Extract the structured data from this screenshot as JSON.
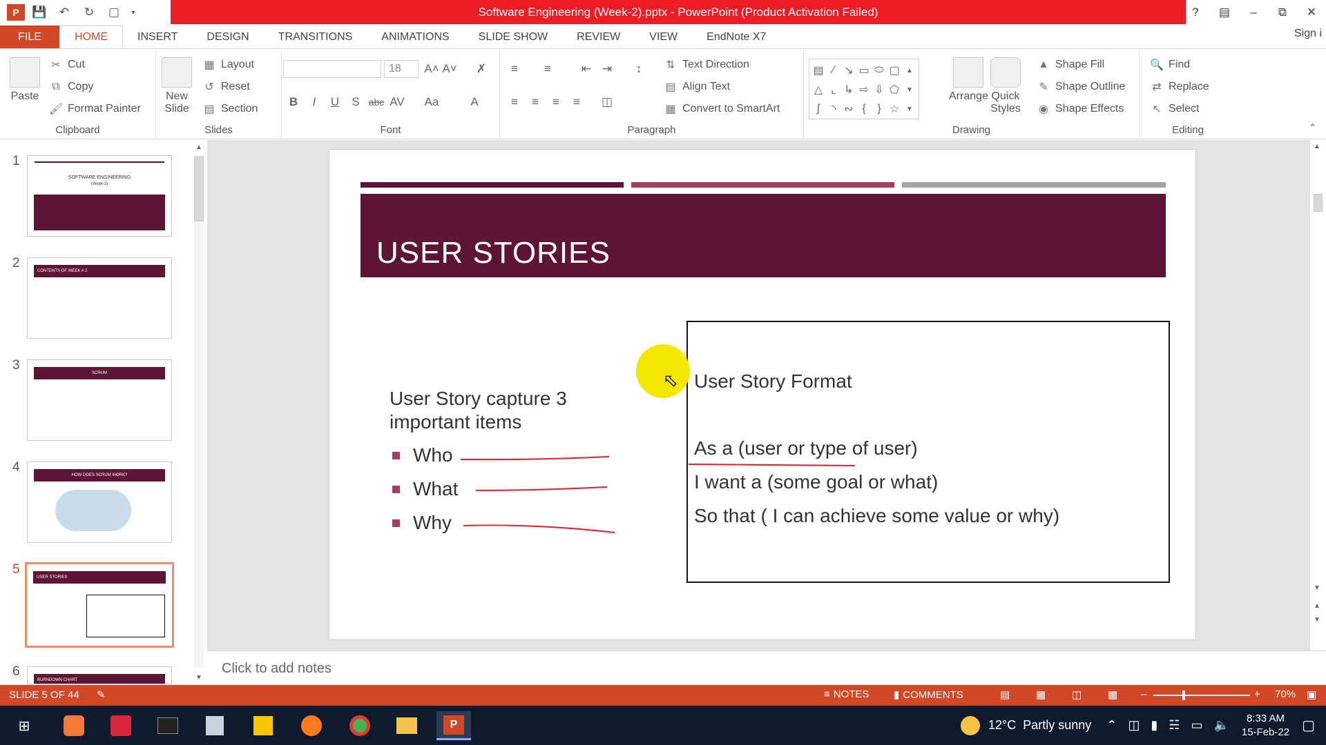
{
  "window": {
    "title": "Software Engineering (Week-2).pptx - PowerPoint (Product Activation Failed)",
    "qat_icons": [
      "powerpoint-logo-icon",
      "save-icon",
      "undo-icon",
      "redo-icon",
      "start-from-beginning-icon",
      "customize-qat-icon"
    ],
    "controls": [
      "help-icon",
      "ribbon-display-icon",
      "minimize-icon",
      "restore-icon",
      "close-icon"
    ]
  },
  "tabs": [
    "FILE",
    "HOME",
    "INSERT",
    "DESIGN",
    "TRANSITIONS",
    "ANIMATIONS",
    "SLIDE SHOW",
    "REVIEW",
    "VIEW",
    "EndNote X7"
  ],
  "active_tab": "HOME",
  "signin": "Sign i",
  "ribbon": {
    "clipboard": {
      "label": "Clipboard",
      "paste": "Paste",
      "cut": "Cut",
      "copy": "Copy",
      "format_painter": "Format Painter"
    },
    "slides": {
      "label": "Slides",
      "new_slide_line1": "New",
      "new_slide_line2": "Slide",
      "layout": "Layout",
      "reset": "Reset",
      "section": "Section"
    },
    "font": {
      "label": "Font",
      "font_name": "",
      "font_size": "18"
    },
    "paragraph": {
      "label": "Paragraph",
      "text_direction": "Text Direction",
      "align_text": "Align Text",
      "convert_smartart": "Convert to SmartArt"
    },
    "drawing": {
      "label": "Drawing",
      "arrange": "Arrange",
      "quick_styles_line1": "Quick",
      "quick_styles_line2": "Styles",
      "shape_fill": "Shape Fill",
      "shape_outline": "Shape Outline",
      "shape_effects": "Shape Effects"
    },
    "editing": {
      "label": "Editing",
      "find": "Find",
      "replace": "Replace",
      "select": "Select"
    }
  },
  "thumbnails": [
    {
      "num": "1",
      "title": "SOFTWARE ENGINEERING",
      "sub": "(Week-2)"
    },
    {
      "num": "2",
      "title": "CONTENTS OF WEEK # 2"
    },
    {
      "num": "3",
      "title": "SCRUM"
    },
    {
      "num": "4",
      "title": "HOW DOES SCRUM WORK?"
    },
    {
      "num": "5",
      "title": "USER STORIES"
    },
    {
      "num": "6",
      "title": "BURNDOWN CHART"
    }
  ],
  "slide": {
    "title": "USER STORIES",
    "intro": "User Story capture 3 important items",
    "bullets": [
      "Who",
      "What",
      "Why"
    ],
    "format_heading": "User Story Format",
    "format_lines": [
      "As a (user or type of user)",
      "I want a (some goal or what)",
      "So that ( I can achieve some value or why)"
    ],
    "colors": {
      "title_band": "#5e1535",
      "bar1": "#5e1535",
      "bar2": "#a0405f",
      "bar3": "#a5a5a5",
      "annotation": "#e0202a"
    }
  },
  "notes_placeholder": "Click to add notes",
  "status": {
    "slide_info": "SLIDE 5 OF 44",
    "notes": "NOTES",
    "comments": "COMMENTS",
    "zoom": "70%"
  },
  "taskbar": {
    "weather_temp": "12°C",
    "weather_desc": "Partly sunny",
    "time": "8:33 AM",
    "date": "15-Feb-22"
  }
}
